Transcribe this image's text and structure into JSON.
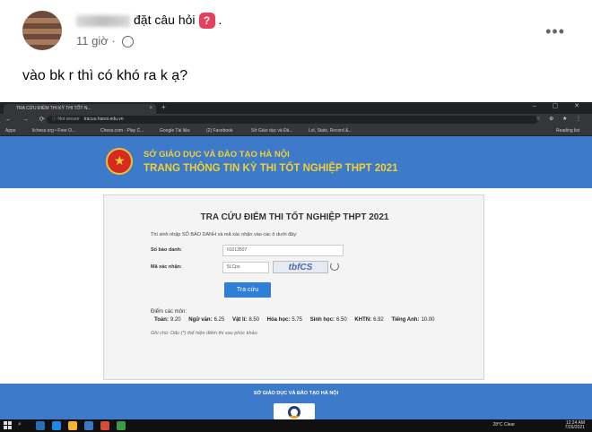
{
  "post": {
    "question_suffix": "đặt câu hỏi",
    "question_badge": "?",
    "period": ".",
    "time": "11 giờ",
    "more": "•••",
    "text": "vào bk r thì có khó ra k ạ?"
  },
  "browser": {
    "tab_title": "TRA CỨU ĐIỂM THI KỲ THI TỐT N...",
    "tab_close": "×",
    "tab_plus": "+",
    "window_controls": "– ▢ ✕",
    "nav_icons": "← → ⟳",
    "not_secure": "ⓘ Not secure",
    "url": "tracuu.hanoi.edu.vn",
    "right_icons": "☆ ⊕ ★ ⋮",
    "bookmarks": [
      "Apps",
      "lichess.org • Free O...",
      "Chess.com - Play C...",
      "Google Tài liệu",
      "(2) Facebook",
      "Sở Giáo dục và Đà...",
      "Lol, Stats, Record &...",
      "Reading list"
    ]
  },
  "site": {
    "dept": "SỞ GIÁO DỤC VÀ ĐÀO TẠO HÀ NỘI",
    "portal": "TRANG THÔNG TIN KỲ THI TỐT NGHIỆP THPT 2021",
    "footer": "SỞ GIÁO DỤC VÀ ĐÀO TẠO HÀ NỘI"
  },
  "form": {
    "title": "TRA CỨU ĐIỂM THI TỐT NGHIỆP THPT 2021",
    "hint": "Thí sinh nhập SỐ BÁO DANH và mã xác nhận vào các ô dưới đây:",
    "sbd_label": "Số báo danh:",
    "sbd_value": "01013507",
    "captcha_label": "Mã xác nhận:",
    "captcha_value": "5LCps",
    "captcha_image_text": "tbfCS",
    "submit": "Tra cứu",
    "scores_label": "Điểm các môn:",
    "scores": [
      {
        "subject": "Toán:",
        "score": "9.20"
      },
      {
        "subject": "Ngữ văn:",
        "score": "6.25"
      },
      {
        "subject": "Vật lí:",
        "score": "8.50"
      },
      {
        "subject": "Hóa học:",
        "score": "5.75"
      },
      {
        "subject": "Sinh học:",
        "score": "6.50"
      },
      {
        "subject": "KHTN:",
        "score": "6.92"
      },
      {
        "subject": "Tiếng Anh:",
        "score": "10.00"
      }
    ],
    "note": "Ghi chú: Dấu (*) thể hiện điểm thi sau phúc khảo"
  },
  "taskbar": {
    "weather": "28°C  Clear",
    "time": "12:24 AM",
    "date": "7/26/2021"
  }
}
